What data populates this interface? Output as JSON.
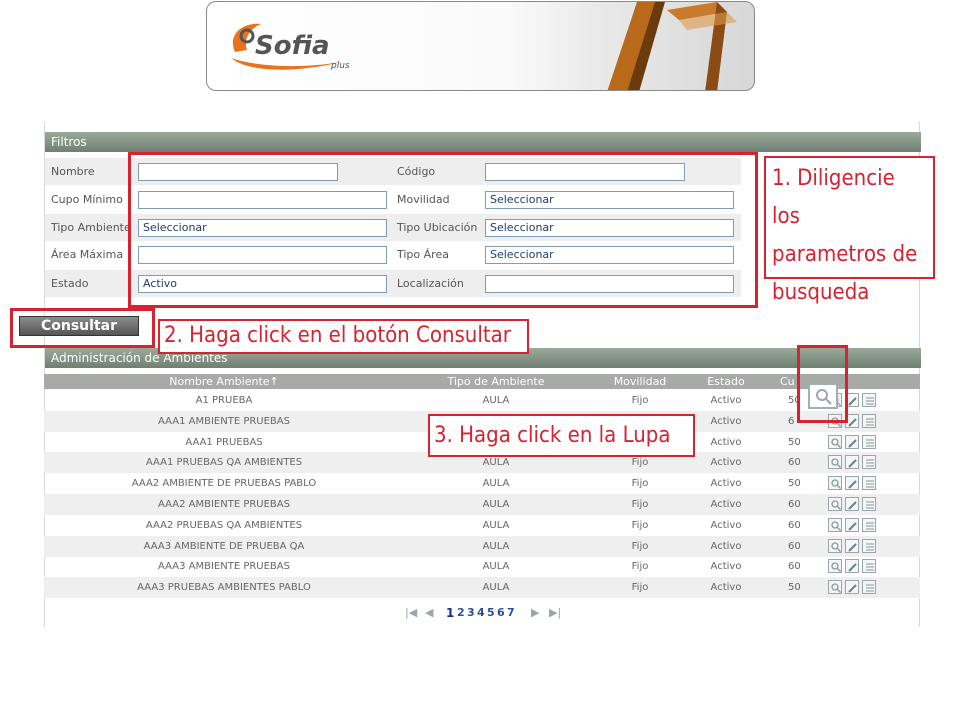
{
  "branding": {
    "logo_text": "Sofia",
    "logo_sub": "plus"
  },
  "filters": {
    "title": "Filtros",
    "rows": [
      {
        "left_label": "Nombre",
        "left_value": "",
        "right_label": "Código",
        "right_value": ""
      },
      {
        "left_label": "Cupo Mínimo",
        "left_value": "",
        "right_label": "Movilidad",
        "right_value": "Seleccionar"
      },
      {
        "left_label": "Tipo Ambiente",
        "left_value": "Seleccionar",
        "right_label": "Tipo Ubicación",
        "right_value": "Seleccionar"
      },
      {
        "left_label": "Área Máxima",
        "left_value": "",
        "right_label": "Tipo Área",
        "right_value": "Seleccionar"
      },
      {
        "left_label": "Estado",
        "left_value": "Activo",
        "right_label": "Localización",
        "right_value": ""
      }
    ]
  },
  "consult_button": "Consultar",
  "admin": {
    "title": "Administración de Ambientes",
    "columns": [
      "Nombre Ambiente↑",
      "Tipo de Ambiente",
      "Movilidad",
      "Estado",
      "Cu"
    ],
    "rows": [
      {
        "name": "A1 PRUEBA",
        "tipo": "AULA",
        "movilidad": "Fijo",
        "estado": "Activo",
        "cupo": "50"
      },
      {
        "name": "AAA1 AMBIENTE PRUEBAS",
        "tipo": "",
        "movilidad": "",
        "estado": "Activo",
        "cupo": "6"
      },
      {
        "name": "AAA1 PRUEBAS",
        "tipo": "",
        "movilidad": "",
        "estado": "Activo",
        "cupo": "50"
      },
      {
        "name": "AAA1 PRUEBAS QA AMBIENTES",
        "tipo": "AULA",
        "movilidad": "Fijo",
        "estado": "Activo",
        "cupo": "60"
      },
      {
        "name": "AAA2 AMBIENTE DE PRUEBAS PABLO",
        "tipo": "AULA",
        "movilidad": "Fijo",
        "estado": "Activo",
        "cupo": "50"
      },
      {
        "name": "AAA2 AMBIENTE PRUEBAS",
        "tipo": "AULA",
        "movilidad": "Fijo",
        "estado": "Activo",
        "cupo": "60"
      },
      {
        "name": "AAA2 PRUEBAS QA AMBIENTES",
        "tipo": "AULA",
        "movilidad": "Fijo",
        "estado": "Activo",
        "cupo": "60"
      },
      {
        "name": "AAA3 AMBIENTE DE PRUEBA QA",
        "tipo": "AULA",
        "movilidad": "Fijo",
        "estado": "Activo",
        "cupo": "60"
      },
      {
        "name": "AAA3 AMBIENTE PRUEBAS",
        "tipo": "AULA",
        "movilidad": "Fijo",
        "estado": "Activo",
        "cupo": "60"
      },
      {
        "name": "AAA3 PRUEBAS AMBIENTES PABLO",
        "tipo": "AULA",
        "movilidad": "Fijo",
        "estado": "Activo",
        "cupo": "50"
      }
    ]
  },
  "pager": {
    "first": "|◀",
    "prev": "◀",
    "pages": [
      "1",
      "2",
      "3",
      "4",
      "5",
      "6",
      "7"
    ],
    "next": "▶",
    "last": "▶|"
  },
  "annotations": {
    "step1": [
      "1. Diligencie los",
      "parametros de",
      "busqueda"
    ],
    "step2": "2. Haga click en el botón Consultar",
    "step3": "3. Haga click en la Lupa"
  },
  "colors": {
    "annotation": "#d7232f",
    "header_green": "#6f7f72",
    "logo_orange": "#e8731c"
  }
}
